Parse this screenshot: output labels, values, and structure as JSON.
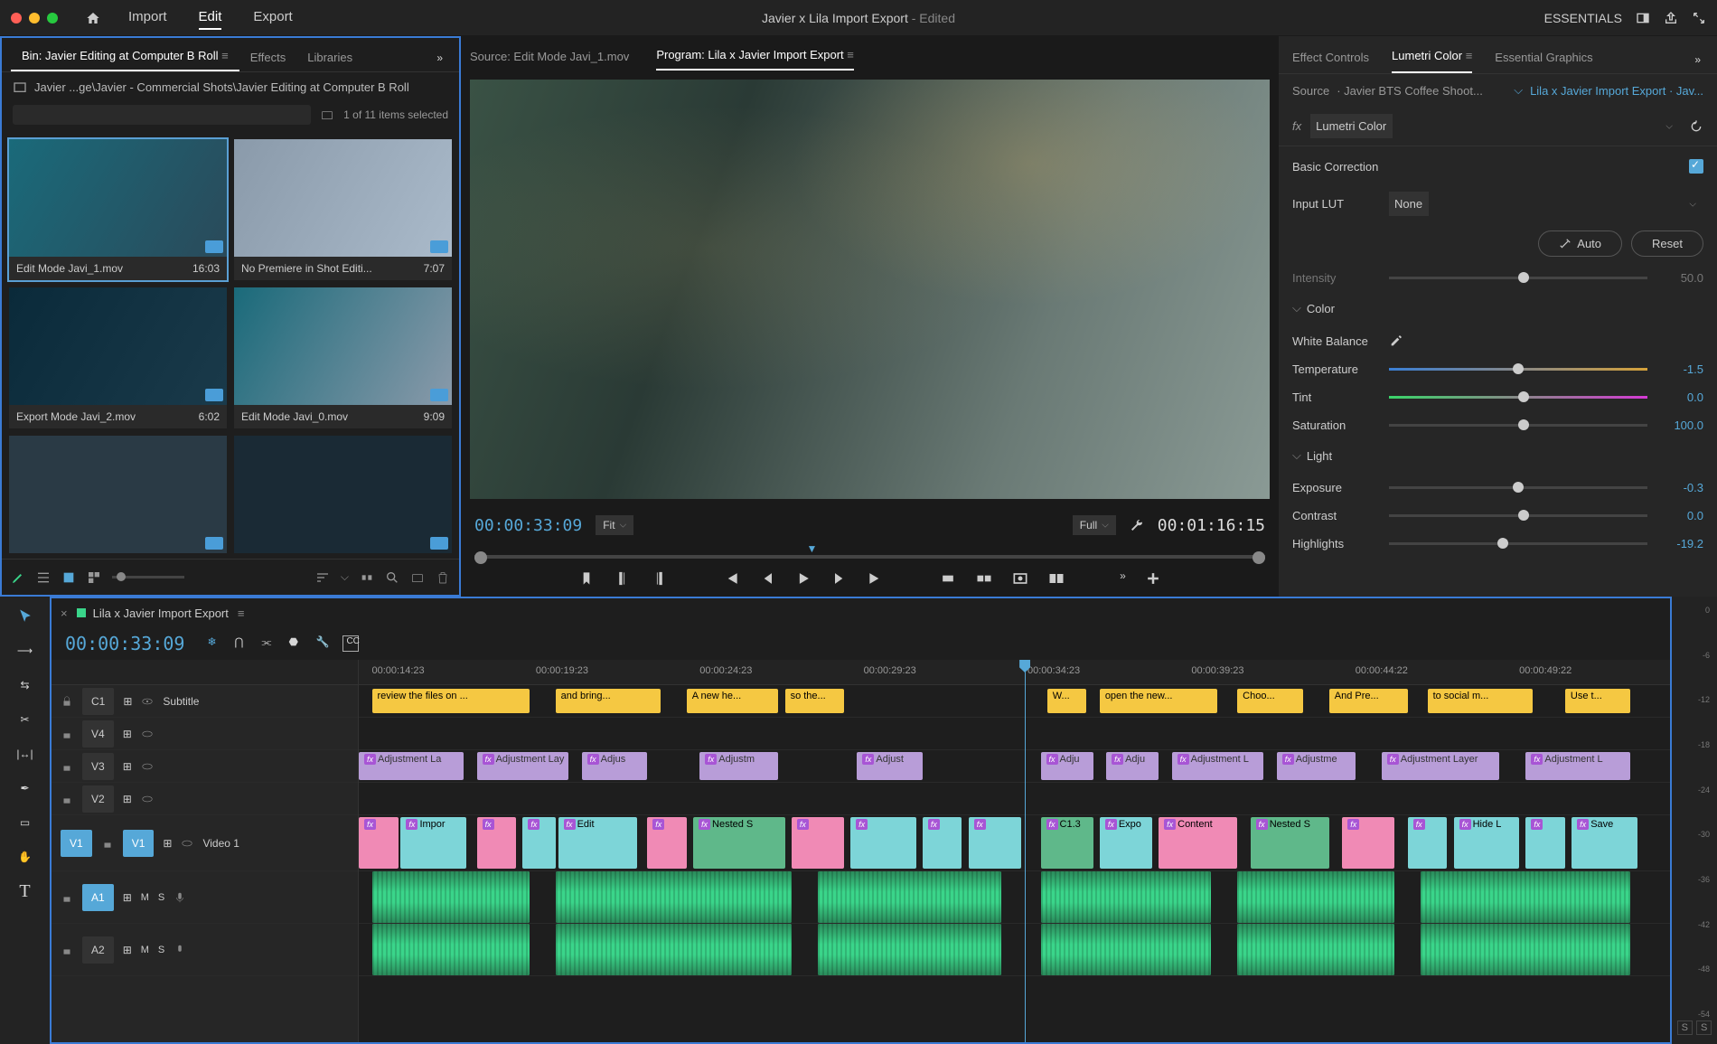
{
  "titlebar": {
    "title": "Javier x Lila Import Export",
    "edited": "- Edited",
    "workspace": "ESSENTIALS"
  },
  "main_tabs": [
    "Import",
    "Edit",
    "Export"
  ],
  "main_tabs_active": 1,
  "project": {
    "tabs": [
      "Bin: Javier Editing at Computer B Roll",
      "Effects",
      "Libraries"
    ],
    "tabs_active": 0,
    "breadcrumb": "Javier ...ge\\Javier - Commercial Shots\\Javier Editing at Computer B Roll",
    "search_placeholder": "",
    "item_status": "1 of 11 items selected",
    "clips": [
      {
        "name": "Edit Mode Javi_1.mov",
        "dur": "16:03",
        "selected": true
      },
      {
        "name": "No Premiere in Shot Editi...",
        "dur": "7:07",
        "selected": false
      },
      {
        "name": "Export Mode Javi_2.mov",
        "dur": "6:02",
        "selected": false
      },
      {
        "name": "Edit Mode Javi_0.mov",
        "dur": "9:09",
        "selected": false
      }
    ]
  },
  "monitor": {
    "source_tab": "Source: Edit Mode Javi_1.mov",
    "program_tab": "Program: Lila x Javier Import Export",
    "timecode_left": "00:00:33:09",
    "timecode_right": "00:01:16:15",
    "fit": "Fit",
    "full": "Full"
  },
  "lumetri": {
    "tabs": [
      "Effect Controls",
      "Lumetri Color",
      "Essential Graphics"
    ],
    "tabs_active": 1,
    "source_label": "Source ",
    "source_clip": "· Javier BTS Coffee Shoot...",
    "sequence": "Lila x Javier Import Export · Jav...",
    "effect_name": "Lumetri Color",
    "basic_correction": "Basic Correction",
    "input_lut_label": "Input LUT",
    "input_lut_value": "None",
    "auto": "Auto",
    "reset": "Reset",
    "intensity_label": "Intensity",
    "intensity_value": "50.0",
    "color_section": "Color",
    "white_balance": "White Balance",
    "temperature": {
      "label": "Temperature",
      "value": "-1.5",
      "pos": 48
    },
    "tint": {
      "label": "Tint",
      "value": "0.0",
      "pos": 50
    },
    "saturation": {
      "label": "Saturation",
      "value": "100.0",
      "pos": 50
    },
    "light_section": "Light",
    "exposure": {
      "label": "Exposure",
      "value": "-0.3",
      "pos": 48
    },
    "contrast": {
      "label": "Contrast",
      "value": "0.0",
      "pos": 50
    },
    "highlights": {
      "label": "Highlights",
      "value": "-19.2",
      "pos": 42
    }
  },
  "timeline": {
    "name": "Lila x Javier Import Export",
    "timecode": "00:00:33:09",
    "ruler": [
      "00:00:14:23",
      "00:00:19:23",
      "00:00:24:23",
      "00:00:29:23",
      "00:00:34:23",
      "00:00:39:23",
      "00:00:44:22",
      "00:00:49:22"
    ],
    "playhead_pct": 50.8,
    "tracks": {
      "c1": {
        "label": "C1",
        "name": "Subtitle"
      },
      "v4": {
        "label": "V4"
      },
      "v3": {
        "label": "V3"
      },
      "v2": {
        "label": "V2"
      },
      "v1": {
        "label": "V1",
        "name": "Video 1",
        "source": "V1"
      },
      "a1": {
        "label": "A1",
        "source": "A1"
      },
      "a2": {
        "label": "A2"
      }
    },
    "captions": [
      {
        "l": 1,
        "w": 12,
        "t": "review the files on ..."
      },
      {
        "l": 15,
        "w": 8,
        "t": "and bring..."
      },
      {
        "l": 25,
        "w": 7,
        "t": "A new he..."
      },
      {
        "l": 32.5,
        "w": 4.5,
        "t": "so the..."
      },
      {
        "l": 52.5,
        "w": 3,
        "t": "W..."
      },
      {
        "l": 56.5,
        "w": 9,
        "t": "open the new..."
      },
      {
        "l": 67,
        "w": 5,
        "t": "Choo..."
      },
      {
        "l": 74,
        "w": 6,
        "t": "And Pre..."
      },
      {
        "l": 81.5,
        "w": 8,
        "t": "to social m..."
      },
      {
        "l": 92,
        "w": 5,
        "t": "Use t..."
      }
    ],
    "v3_clips": [
      {
        "l": 0,
        "w": 8,
        "t": "Adjustment La"
      },
      {
        "l": 9,
        "w": 7,
        "t": "Adjustment Lay"
      },
      {
        "l": 17,
        "w": 5,
        "t": "Adjus"
      },
      {
        "l": 26,
        "w": 6,
        "t": "Adjustm"
      },
      {
        "l": 38,
        "w": 5,
        "t": "Adjust"
      },
      {
        "l": 52,
        "w": 4,
        "t": "Adju"
      },
      {
        "l": 57,
        "w": 4,
        "t": "Adju"
      },
      {
        "l": 62,
        "w": 7,
        "t": "Adjustment L"
      },
      {
        "l": 70,
        "w": 6,
        "t": "Adjustme"
      },
      {
        "l": 78,
        "w": 9,
        "t": "Adjustment Layer"
      },
      {
        "l": 89,
        "w": 8,
        "t": "Adjustment L"
      }
    ],
    "v1_clips": [
      {
        "l": 0,
        "w": 3,
        "c": "pink"
      },
      {
        "l": 3.2,
        "w": 5,
        "c": "video",
        "t": "Impor"
      },
      {
        "l": 9,
        "w": 3,
        "c": "pink"
      },
      {
        "l": 12.5,
        "w": 2.5,
        "c": "video"
      },
      {
        "l": 15.2,
        "w": 6,
        "c": "video",
        "t": "Edit"
      },
      {
        "l": 22,
        "w": 3,
        "c": "pink"
      },
      {
        "l": 25.5,
        "w": 7,
        "c": "nested",
        "t": "Nested S"
      },
      {
        "l": 33,
        "w": 4,
        "c": "pink"
      },
      {
        "l": 37.5,
        "w": 5,
        "c": "video"
      },
      {
        "l": 43,
        "w": 3,
        "c": "video"
      },
      {
        "l": 46.5,
        "w": 4,
        "c": "video"
      },
      {
        "l": 52,
        "w": 4,
        "c": "nested",
        "t": "C1.3"
      },
      {
        "l": 56.5,
        "w": 4,
        "c": "video",
        "t": "Expo"
      },
      {
        "l": 61,
        "w": 6,
        "c": "pink",
        "t": "Content"
      },
      {
        "l": 68,
        "w": 6,
        "c": "nested",
        "t": "Nested S"
      },
      {
        "l": 75,
        "w": 4,
        "c": "pink"
      },
      {
        "l": 80,
        "w": 3,
        "c": "video"
      },
      {
        "l": 83.5,
        "w": 5,
        "c": "video",
        "t": "Hide L"
      },
      {
        "l": 89,
        "w": 3,
        "c": "video"
      },
      {
        "l": 92.5,
        "w": 5,
        "c": "video",
        "t": "Save"
      }
    ]
  },
  "meters": {
    "ticks": [
      "0",
      "-6",
      "-12",
      "-18",
      "-24",
      "-30",
      "-36",
      "-42",
      "-48",
      "-54"
    ],
    "solo": "S"
  }
}
